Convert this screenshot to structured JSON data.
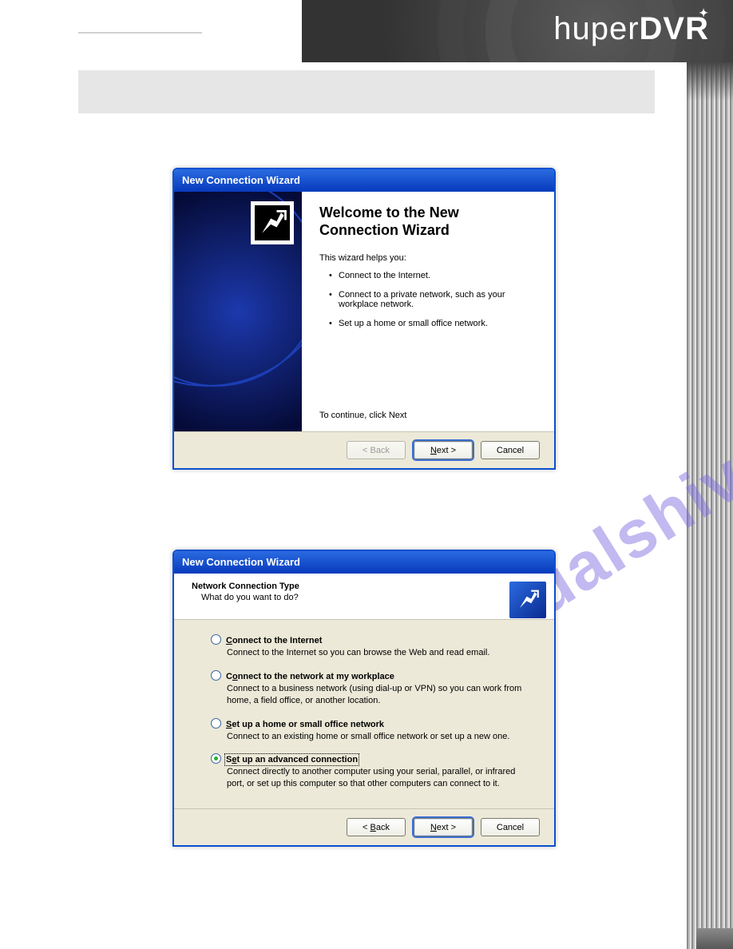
{
  "header": {
    "brand_thin": "huper",
    "brand_bold": "DVR"
  },
  "watermark": "manualshive.com",
  "wizard1": {
    "title": "New Connection Wizard",
    "heading": "Welcome to the New Connection Wizard",
    "lead": "This wizard helps you:",
    "bullets": [
      "Connect to the Internet.",
      "Connect to a private network, such as your workplace network.",
      "Set up a home or small office network."
    ],
    "continue": "To continue, click Next",
    "buttons": {
      "back": "< Back",
      "next": "Next >",
      "cancel": "Cancel"
    }
  },
  "wizard2": {
    "title": "New Connection Wizard",
    "heading": "Network Connection Type",
    "sub": "What do you want to do?",
    "options": [
      {
        "label": "Connect to the Internet",
        "desc": "Connect to the Internet so you can browse the Web and read email."
      },
      {
        "label": "Connect to the network at my workplace",
        "desc": "Connect to a business network (using dial-up or VPN) so you can work from home, a field office, or another location."
      },
      {
        "label": "Set up a home or small office network",
        "desc": "Connect to an existing home or small office network or set up a new one."
      },
      {
        "label": "Set up an advanced connection",
        "desc": "Connect directly to another computer using your serial, parallel, or infrared port, or set up this computer so that other computers can connect to it."
      }
    ],
    "selected_index": 3,
    "buttons": {
      "back": "< Back",
      "next": "Next >",
      "cancel": "Cancel"
    }
  }
}
